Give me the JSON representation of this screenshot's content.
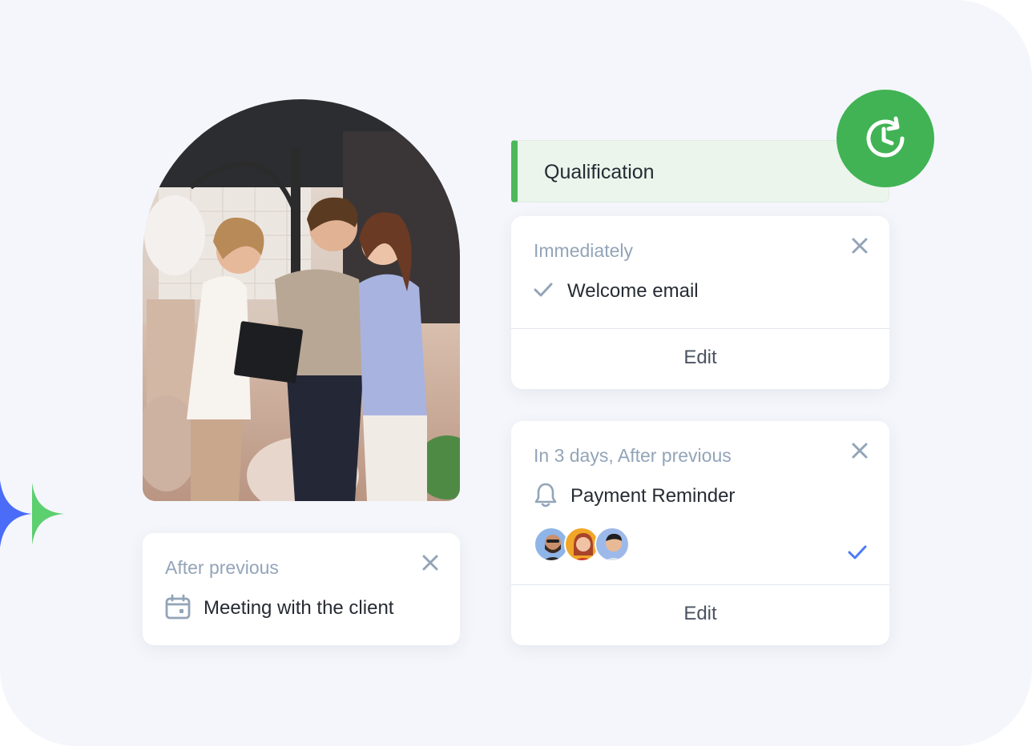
{
  "stage": {
    "label": "Qualification",
    "accent_color": "#4cb859"
  },
  "badge": {
    "icon": "clock-refresh-icon",
    "color": "#41b354"
  },
  "cards": {
    "welcome": {
      "timing": "Immediately",
      "icon": "check-icon",
      "title": "Welcome email",
      "edit_label": "Edit"
    },
    "payment": {
      "timing": "In 3 days, After previous",
      "icon": "bell-icon",
      "title": "Payment Reminder",
      "edit_label": "Edit",
      "assignees": [
        "avatar-bearded-man",
        "avatar-red-haired-woman",
        "avatar-smiling-man"
      ],
      "status_icon": "check-icon",
      "status_color": "#4a7cf5"
    },
    "meeting": {
      "timing": "After previous",
      "icon": "calendar-icon",
      "title": "Meeting with the client"
    }
  },
  "photo": {
    "subject": "three people looking at a clipboard in a restaurant"
  },
  "decor": {
    "sparkle_colors": [
      "#4a6cf7",
      "#5ccf6e"
    ]
  }
}
